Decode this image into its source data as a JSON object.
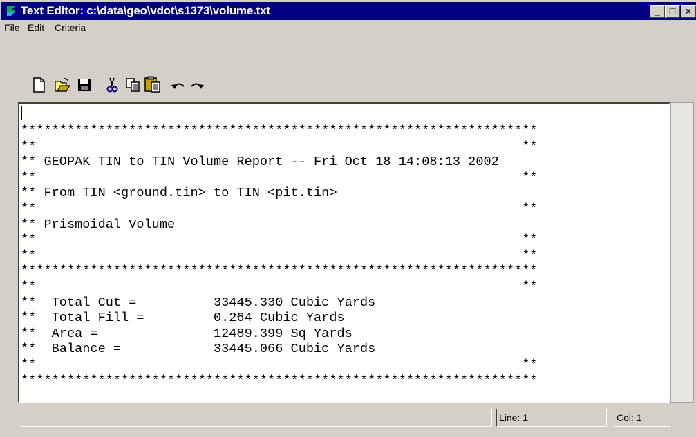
{
  "window": {
    "title": "Text Editor: c:\\data\\geo\\vdot\\s1373\\volume.txt",
    "app_icon": "geopak-logo-icon",
    "controls": {
      "minimize": "_",
      "maximize": "□",
      "close": "×"
    }
  },
  "menu": {
    "items": [
      "File",
      "Edit",
      "Criteria"
    ]
  },
  "toolbar": {
    "tools": [
      "new-file-icon",
      "open-folder-icon",
      "save-icon",
      "cut-icon",
      "copy-icon",
      "paste-icon",
      "undo-icon",
      "redo-icon"
    ]
  },
  "editor": {
    "lines": [
      "*******************************************************************",
      "**                                                               **",
      "** GEOPAK TIN to TIN Volume Report -- Fri Oct 18 14:08:13 2002",
      "**                                                               **",
      "** From TIN <ground.tin> to TIN <pit.tin>",
      "**                                                               **",
      "** Prismoidal Volume",
      "**                                                               **",
      "**                                                               **",
      "*******************************************************************",
      "**                                                               **",
      "**  Total Cut =          33445.330 Cubic Yards",
      "**  Total Fill =         0.264 Cubic Yards",
      "**  Area =               12489.399 Sq Yards",
      "**  Balance =            33445.066 Cubic Yards",
      "**                                                               **",
      "*******************************************************************"
    ]
  },
  "status": {
    "message": "",
    "line": "Line: 1",
    "col": "Col: 1"
  }
}
